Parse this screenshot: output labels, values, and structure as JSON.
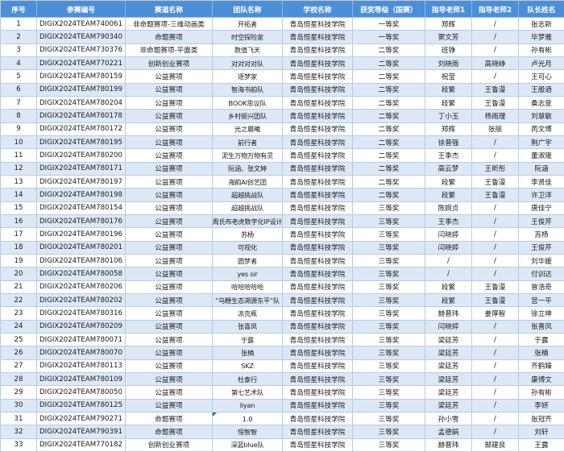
{
  "table": {
    "headers": [
      "序号",
      "参赛编号",
      "赛道名称",
      "团队名称",
      "学校名称",
      "获奖等级（国赛）",
      "指导老师1",
      "指导老师2",
      "队长姓名"
    ],
    "rows": [
      [
        "1",
        "DIGIX2024TEAM740061",
        "非命题赛项-三维动画类",
        "开拓者",
        "青岛恒星科技学院",
        "一等奖",
        "郑辉",
        "/",
        "张志新"
      ],
      [
        "2",
        "DIGIX2024TEAM790340",
        "命题赛项",
        "时空探险家",
        "青岛恒星科技学院",
        "一等奖",
        "窦文芳",
        "/",
        "毕梦雅"
      ],
      [
        "3",
        "DIGIX2024TEAM730376",
        "非命题赛项-平面类",
        "数值飞天",
        "青岛恒星科技学院",
        "二等奖",
        "班铮",
        "/",
        "孙有彬"
      ],
      [
        "4",
        "DIGIX2024TEAM770221",
        "创新创业赛项",
        "对对对对队",
        "青岛恒星科技学院",
        "二等奖",
        "刘晓雨",
        "高晓峥",
        "卢光月"
      ],
      [
        "5",
        "DIGIX2024TEAM780159",
        "公益赛项",
        "逐梦家",
        "青岛恒星科技学院",
        "二等奖",
        "祝莹",
        "/",
        "王可心"
      ],
      [
        "6",
        "DIGIX2024TEAM780199",
        "公益赛项",
        "智海书韵队",
        "青岛恒星科技学院",
        "二等奖",
        "段繁",
        "王鲁漫",
        "王般迺"
      ],
      [
        "7",
        "DIGIX2024TEAM780204",
        "公益赛项",
        "BOOK思议队",
        "青岛恒星科技学院",
        "二等奖",
        "段繁",
        "王鲁漫",
        "桑志萱"
      ],
      [
        "8",
        "DIGIX2024TEAM780178",
        "公益赛项",
        "乡村振兴团队",
        "青岛恒星科技学院",
        "二等奖",
        "丁小玉",
        "杨雨理",
        "刘慧敏"
      ],
      [
        "9",
        "DIGIX2024TEAM780172",
        "公益赛项",
        "光之晨曦",
        "青岛恒星科技学院",
        "二等奖",
        "郑辉",
        "张丽",
        "芮文博"
      ],
      [
        "10",
        "DIGIX2024TEAM780195",
        "公益赛项",
        "前行者",
        "青岛恒星科技学院",
        "二等奖",
        "徐晋强",
        "/",
        "荆广宇"
      ],
      [
        "11",
        "DIGIX2024TEAM780200",
        "公益赛项",
        "泥生万物万物有灵",
        "青岛恒星科技学院",
        "二等奖",
        "王季杰",
        "/",
        "董淑瑗"
      ],
      [
        "12",
        "DIGIX2024TEAM780171",
        "公益赛项",
        "阮涵、张文婷",
        "青岛恒星科技学院",
        "二等奖",
        "高云梦",
        "王昕彤",
        "阮涵"
      ],
      [
        "13",
        "DIGIX2024TEAM780197",
        "公益赛项",
        "海韵AI创艺团",
        "青岛恒星科技学院",
        "二等奖",
        "段繁",
        "王鲁漫",
        "李贤佳"
      ],
      [
        "14",
        "DIGIX2024TEAM780198",
        "公益赛项",
        "超越挑战队",
        "青岛恒星科技学院",
        "二等奖",
        "段繁",
        "王鲁漫",
        "许卫洋"
      ],
      [
        "15",
        "DIGIX2024TEAM780154",
        "公益赛项",
        "超越挑战队",
        "青岛恒星科技学院",
        "三等奖",
        "陈婉贞",
        "/",
        "唐佳宁"
      ],
      [
        "16",
        "DIGIX2024TEAM780176",
        "公益赛项",
        "周氏布老虎数字化IP设计",
        "青岛恒星科技学院",
        "三等奖",
        "王季杰",
        "/",
        "王俊芹"
      ],
      [
        "17",
        "DIGIX2024TEAM780196",
        "公益赛项",
        "苏杨",
        "青岛恒星科技学院",
        "三等奖",
        "闫晓婷",
        "/",
        "苏杨"
      ],
      [
        "18",
        "DIGIX2024TEAM780201",
        "公益赛项",
        "可视化",
        "青岛恒星科技学院",
        "三等奖",
        "闫晓婷",
        "/",
        "王俊芹"
      ],
      [
        "19",
        "DIGIX2024TEAM780106",
        "公益赛项",
        "圆梦者",
        "青岛恒星科技学院",
        "三等奖",
        "/",
        "/",
        "刘华媛"
      ],
      [
        "20",
        "DIGIX2024TEAM780058",
        "公益赛项",
        "yes sir",
        "青岛恒星科技学院",
        "三等奖",
        "/",
        "/",
        "付训达"
      ],
      [
        "21",
        "DIGIX2024TEAM780206",
        "公益赛项",
        "哈哈哈哈哈",
        "青岛恒星科技学院",
        "三等奖",
        "段繁",
        "王鲁漫",
        "曾浩奇"
      ],
      [
        "22",
        "DIGIX2024TEAM780202",
        "公益赛项",
        "“乌鞭生态溯源东平”队",
        "青岛恒星科技学院",
        "三等奖",
        "段繁",
        "王鲁漫",
        "宫一平"
      ],
      [
        "23",
        "DIGIX2024TEAM780316",
        "公益赛项",
        "派克瓶",
        "青岛恒星科技学院",
        "三等奖",
        "赫晋玮",
        "姜厚智",
        "徐立坤"
      ],
      [
        "24",
        "DIGIX2024TEAM780209",
        "公益赛项",
        "张喜凤",
        "青岛恒星科技学院",
        "三等奖",
        "闫晓婷",
        "/",
        "张喜凤"
      ],
      [
        "25",
        "DIGIX2024TEAM780071",
        "公益赛项",
        "于露",
        "青岛恒星科技学院",
        "三等奖",
        "梁廷芳",
        "/",
        "于露"
      ],
      [
        "26",
        "DIGIX2024TEAM780070",
        "公益赛项",
        "张楠",
        "青岛恒星科技学院",
        "三等奖",
        "梁廷芳",
        "/",
        "张楠"
      ],
      [
        "27",
        "DIGIX2024TEAM780113",
        "公益赛项",
        "SKZ",
        "青岛恒星科技学院",
        "三等奖",
        "梁廷芳",
        "/",
        "齐鹤臻"
      ],
      [
        "28",
        "DIGIX2024TEAM780109",
        "公益赛项",
        "杜泰行",
        "青岛恒星科技学院",
        "三等奖",
        "梁廷芳",
        "/",
        "康博文"
      ],
      [
        "29",
        "DIGIX2024TEAM780050",
        "公益赛项",
        "第七艺术队",
        "青岛恒星科技学院",
        "三等奖",
        "梁廷芳",
        "/",
        "孙有彬"
      ],
      [
        "30",
        "DIGIX2024TEAM780125",
        "公益赛项",
        "liyan",
        "青岛恒星科技学院",
        "三等奖",
        "梁廷芳",
        "/",
        "李妍"
      ],
      [
        "31",
        "DIGIX2024TEAM790271",
        "命题赛项",
        "1.0",
        "青岛恒星科技学院",
        "三等奖",
        "孙小雪",
        "/",
        "张冠齐"
      ],
      [
        "32",
        "DIGIX2024TEAM790391",
        "命题赛项",
        "恒智智",
        "青岛恒星科技学院",
        "三等奖",
        "孟德娟",
        "/",
        "刘轩"
      ],
      [
        "33",
        "DIGIX2024TEAM770182",
        "创新创业赛项",
        "深蓝blue队",
        "青岛恒星科技学院",
        "三等奖",
        "赫晋玮",
        "郜建良",
        "王露"
      ]
    ]
  },
  "colors": {
    "header_bg": "#4a8fd8",
    "header_text": "#ffffff",
    "alt_row_bg": "#dce8f6",
    "grid_line": "#b7cbe3",
    "error_indicator": "#1e8a3a"
  },
  "icons": {
    "error_indicator": "error-indicator-icon"
  }
}
